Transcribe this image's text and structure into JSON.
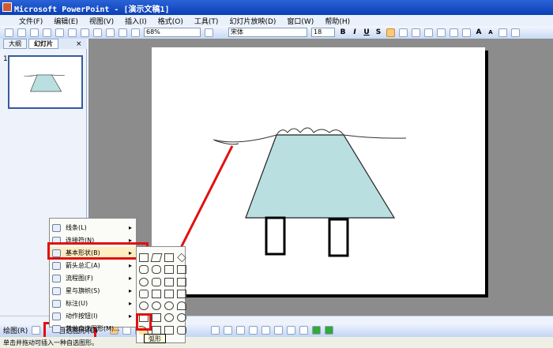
{
  "window": {
    "title": "Microsoft PowerPoint - [演示文稿1]"
  },
  "menubar": [
    "文件(F)",
    "编辑(E)",
    "视图(V)",
    "插入(I)",
    "格式(O)",
    "工具(T)",
    "幻灯片放映(D)",
    "窗口(W)",
    "帮助(H)"
  ],
  "toolbar": {
    "zoom": "68%",
    "font": "宋体",
    "size": "18",
    "bold": "B",
    "italic": "I",
    "underline": "U",
    "shadow": "S",
    "grow": "A",
    "shrink": "A"
  },
  "tabs": [
    "大纲",
    "幻灯片"
  ],
  "slide_number": "1",
  "autoshape_menu": {
    "items": [
      {
        "label": "线条(L)"
      },
      {
        "label": "连接符(N)"
      },
      {
        "label": "基本形状(B)"
      },
      {
        "label": "箭头总汇(A)"
      },
      {
        "label": "流程图(F)"
      },
      {
        "label": "星与旗帜(S)"
      },
      {
        "label": "标注(U)"
      },
      {
        "label": "动作按钮(I)"
      },
      {
        "label": "其他自选图形(M)..."
      }
    ]
  },
  "tooltip": "弧形",
  "drawbar": {
    "draw": "绘图(R)",
    "autoshapes": "自选图形(U)"
  },
  "status": "单击并拖动可插入一种自选图形。",
  "colors": {
    "highlight": "#e01010",
    "shape_fill": "#b9dfe0"
  }
}
